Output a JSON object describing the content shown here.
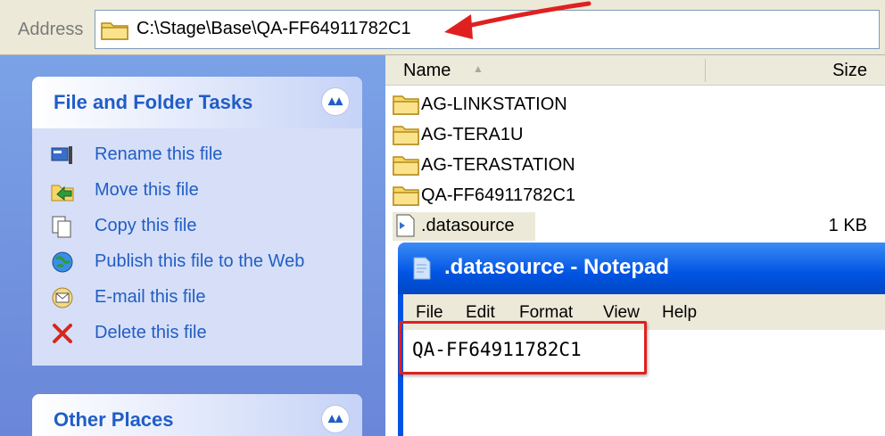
{
  "address_bar": {
    "label": "Address",
    "path": "C:\\Stage\\Base\\QA-FF64911782C1"
  },
  "task_pane": {
    "file_tasks": {
      "title": "File and Folder Tasks",
      "items": [
        {
          "label": "Rename this file",
          "icon": "rename-icon"
        },
        {
          "label": "Move this file",
          "icon": "move-icon"
        },
        {
          "label": "Copy this file",
          "icon": "copy-icon"
        },
        {
          "label": "Publish this file to the Web",
          "icon": "publish-web-icon"
        },
        {
          "label": "E-mail this file",
          "icon": "email-icon"
        },
        {
          "label": "Delete this file",
          "icon": "delete-icon"
        }
      ]
    },
    "other_places": {
      "title": "Other Places"
    }
  },
  "file_list": {
    "columns": {
      "name": "Name",
      "size": "Size"
    },
    "rows": [
      {
        "name": "AG-LINKSTATION",
        "size": "",
        "type": "folder"
      },
      {
        "name": "AG-TERA1U",
        "size": "",
        "type": "folder"
      },
      {
        "name": "AG-TERASTATION",
        "size": "",
        "type": "folder"
      },
      {
        "name": "QA-FF64911782C1",
        "size": "",
        "type": "folder"
      },
      {
        "name": ".datasource",
        "size": "1 KB",
        "type": "file"
      }
    ]
  },
  "notepad": {
    "title": ".datasource - Notepad",
    "menu": [
      "File",
      "Edit",
      "Format",
      "View",
      "Help"
    ],
    "content": "QA-FF64911782C1"
  },
  "colors": {
    "accent": "#215dc6",
    "annotation": "#e02020",
    "titlebar": "#0054e3"
  }
}
